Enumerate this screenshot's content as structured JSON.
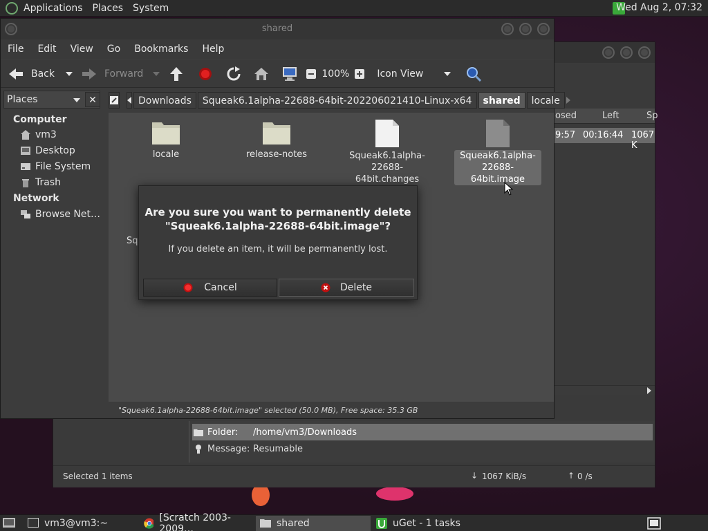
{
  "top_panel": {
    "menus": [
      "Applications",
      "Places",
      "System"
    ],
    "clock": "Wed Aug  2, 07:32"
  },
  "uget": {
    "columns": [
      "osed",
      "Left",
      "Sp"
    ],
    "row": {
      "elapsed": "9:57",
      "left": "00:16:44",
      "speed": "1067 K"
    },
    "folder_label": "Folder:",
    "folder_value": "/home/vm3/Downloads",
    "message_label": "Message:",
    "message_value": "Resumable",
    "status_selected": "Selected 1 items",
    "status_down": "1067 KiB/s",
    "status_up": "0 /s"
  },
  "file_manager": {
    "title": "shared",
    "menu": [
      "File",
      "Edit",
      "View",
      "Go",
      "Bookmarks",
      "Help"
    ],
    "toolbar": {
      "back": "Back",
      "forward": "Forward",
      "zoom": "100%",
      "view_mode": "Icon View"
    },
    "sidebar": {
      "header": "Places",
      "computer_heading": "Computer",
      "computer_items": [
        "vm3",
        "Desktop",
        "File System",
        "Trash"
      ],
      "network_heading": "Network",
      "network_items": [
        "Browse Net…"
      ]
    },
    "path": [
      "Downloads",
      "Squeak6.1alpha-22688-64bit-202206021410-Linux-x64",
      "shared",
      "locale"
    ],
    "files": [
      {
        "name": "locale",
        "type": "folder"
      },
      {
        "name": "release-notes",
        "type": "folder"
      },
      {
        "name": "Squeak6.1alpha-22688-64bit.changes",
        "line1": "Squeak6.1alpha-",
        "line2": "22688-64bit.changes",
        "type": "file"
      },
      {
        "name": "Squeak6.1alpha-22688-64bit.image",
        "line1": "Squeak6.1alpha-",
        "line2": "22688-64bit.image",
        "type": "file",
        "selected": true
      }
    ],
    "hidden_file_fragment": "Sq",
    "status": "\"Squeak6.1alpha-22688-64bit.image\" selected (50.0 MB), Free space: 35.3 GB"
  },
  "dialog": {
    "title_line1": "Are you sure you want to permanently delete",
    "title_line2": "\"Squeak6.1alpha-22688-64bit.image\"?",
    "message": "If you delete an item, it will be permanently lost.",
    "cancel_label": "Cancel",
    "delete_label": "Delete"
  },
  "taskbar": {
    "tasks": [
      "vm3@vm3:~",
      "[Scratch 2003-2009…",
      "shared",
      "uGet - 1 tasks"
    ]
  },
  "colors": {
    "desktop": "#2a1428",
    "window_bg": "#3c3c3c",
    "selection": "#6a6a6a",
    "accent_red": "#d01818",
    "uget_green": "#3aa83a"
  }
}
